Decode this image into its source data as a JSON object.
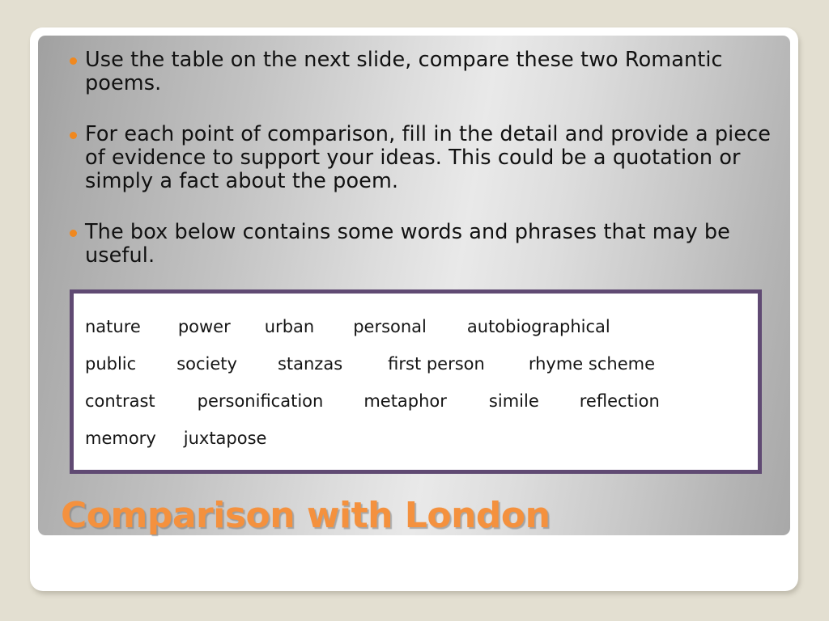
{
  "slide": {
    "title": "Comparison with London",
    "background_color": "#e3dfd1",
    "accent_color": "#f4913e",
    "box_border_color": "#604a73",
    "bullet_color": "#f0881f",
    "bullets": [
      "Use the table on the next slide, compare these two Romantic poems.",
      "For each point of comparison, fill in the detail and provide a piece of evidence to support your ideas. This could be a quotation or simply a fact about the poem.",
      "The box below contains some words and phrases that may be useful."
    ],
    "word_bank": {
      "rows": [
        [
          "nature",
          "power",
          "urban",
          "personal",
          "autobiographical"
        ],
        [
          "public",
          "society",
          "stanzas",
          "first person",
          "rhyme scheme"
        ],
        [
          "contrast",
          "personification",
          "metaphor",
          "simile",
          "reflection"
        ],
        [
          "memory",
          "juxtapose"
        ]
      ],
      "row_gaps": [
        [
          "0px",
          "46px",
          "42px",
          "48px",
          "50px"
        ],
        [
          "0px",
          "50px",
          "50px",
          "56px",
          "54px"
        ],
        [
          "0px",
          "52px",
          "50px",
          "52px",
          "50px"
        ],
        [
          "0px",
          "34px"
        ]
      ]
    }
  }
}
